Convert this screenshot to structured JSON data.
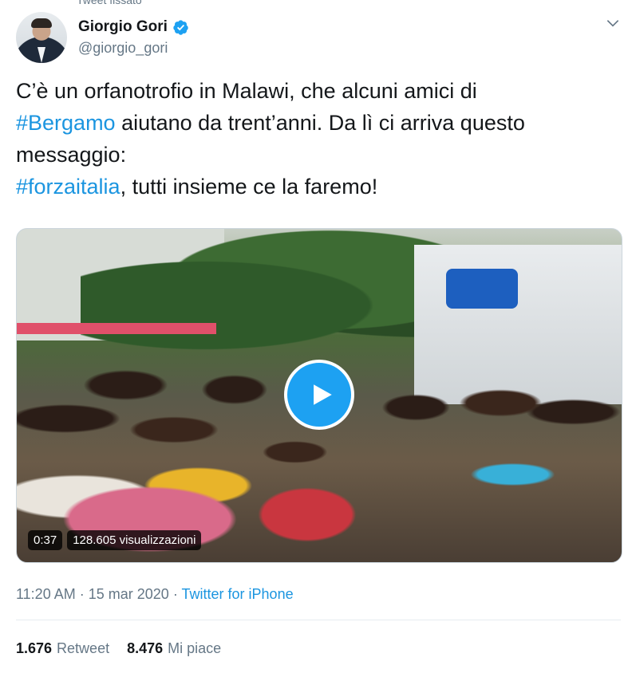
{
  "context_label": "Tweet fissato",
  "author": {
    "name": "Giorgio Gori",
    "handle": "@giorgio_gori",
    "verified": true,
    "verified_color": "#1da1f2"
  },
  "tweet": {
    "segments": [
      {
        "text": "C’è un orfanotrofio in Malawi, che alcuni amici di ",
        "type": "text"
      },
      {
        "text": "#Bergamo",
        "type": "hashtag"
      },
      {
        "text": " aiutano da trent’anni. Da lì ci arriva questo messaggio:",
        "type": "text"
      },
      {
        "text": "#forzaitalia",
        "type": "hashtag"
      },
      {
        "text": ", tutti insieme ce la faremo!",
        "type": "text"
      }
    ]
  },
  "media": {
    "duration": "0:37",
    "views": "128.605 visualizzazioni"
  },
  "meta": {
    "time": "11:20 AM",
    "separator": "·",
    "date": "15 mar 2020",
    "source": "Twitter for iPhone"
  },
  "stats": {
    "retweets_count": "1.676",
    "retweets_label": "Retweet",
    "likes_count": "8.476",
    "likes_label": "Mi piace"
  },
  "colors": {
    "link": "#1b95e0",
    "secondary_text": "#657786",
    "play_button": "#1da1f2"
  },
  "icons": [
    "verified-badge-icon",
    "chevron-down-icon",
    "play-icon"
  ]
}
